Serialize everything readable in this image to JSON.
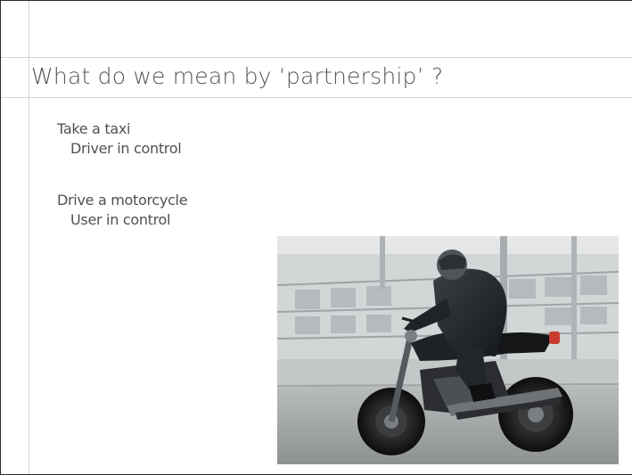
{
  "slide": {
    "title": "What do we mean by ‘partnership’ ?",
    "lines": [
      "Take a taxi",
      "Driver in control",
      "Drive a motorcycle",
      "User in control"
    ]
  },
  "photo": {
    "subject": "motorcycle-rider"
  }
}
